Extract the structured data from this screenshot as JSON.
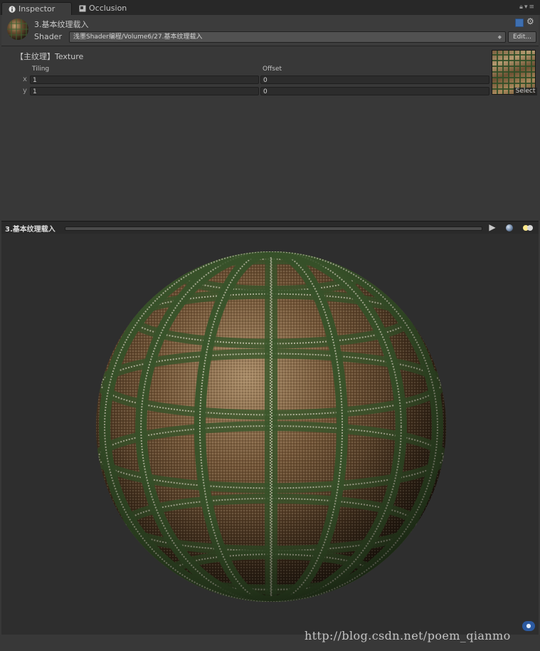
{
  "tabs": [
    {
      "label": "Inspector",
      "icon": "info-icon",
      "active": true
    },
    {
      "label": "Occlusion",
      "icon": "occlusion-icon",
      "active": false
    }
  ],
  "window_controls": {
    "lock_icon": "lock-icon",
    "menu_icon": "menu-icon"
  },
  "material": {
    "name": "3.基本纹理载入",
    "shader_label": "Shader",
    "shader_value": "浅墨Shader编程/Volume6/27.基本纹理载入",
    "edit_label": "Edit...",
    "help_icon": "book-icon",
    "settings_icon": "gear-icon"
  },
  "texture_property": {
    "label": "【主纹理】Texture",
    "tiling_label": "Tiling",
    "offset_label": "Offset",
    "rows": [
      {
        "axis": "x",
        "tiling": "1",
        "offset": "0"
      },
      {
        "axis": "y",
        "tiling": "1",
        "offset": "0"
      }
    ],
    "select_label": "Select"
  },
  "preview": {
    "title": "3.基本纹理载入",
    "play_icon": "play-icon",
    "sphere_icon": "sphere-icon",
    "lights_icon": "lights-icon"
  },
  "watermark": "http://blog.csdn.net/poem_qianmo",
  "colors": {
    "background": "#383838",
    "toolbar": "#2a2a2a",
    "preview_bg": "#2e2e2e",
    "plaid_green": "#3d5a2e",
    "plaid_brown": "#6b4a2c",
    "accent_blue": "#3e6fb0"
  }
}
